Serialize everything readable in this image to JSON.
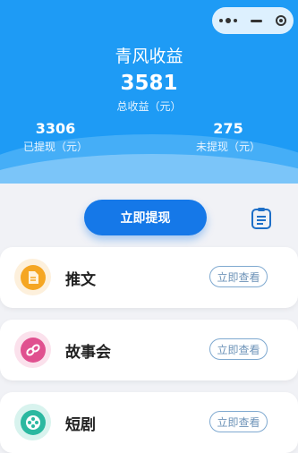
{
  "header": {
    "title": "青风收益",
    "total_amount": "3581",
    "total_label": "总收益（元）",
    "withdrawn_amount": "3306",
    "withdrawn_label": "已提现（元）",
    "pending_amount": "275",
    "pending_label": "未提现（元）"
  },
  "actions": {
    "withdraw_label": "立即提现",
    "record_icon": "clipboard-icon"
  },
  "items": [
    {
      "name": "推文",
      "button": "立即查看",
      "icon": "document-icon",
      "color": "#f5a623"
    },
    {
      "name": "故事会",
      "button": "立即查看",
      "icon": "link-icon",
      "color": "#e0508f"
    },
    {
      "name": "短剧",
      "button": "立即查看",
      "icon": "film-reel-icon",
      "color": "#2bb8a0"
    }
  ],
  "colors": {
    "header_bg": "#1e9bf5",
    "primary_button": "#1578e8",
    "page_bg": "#f1f2f6"
  }
}
